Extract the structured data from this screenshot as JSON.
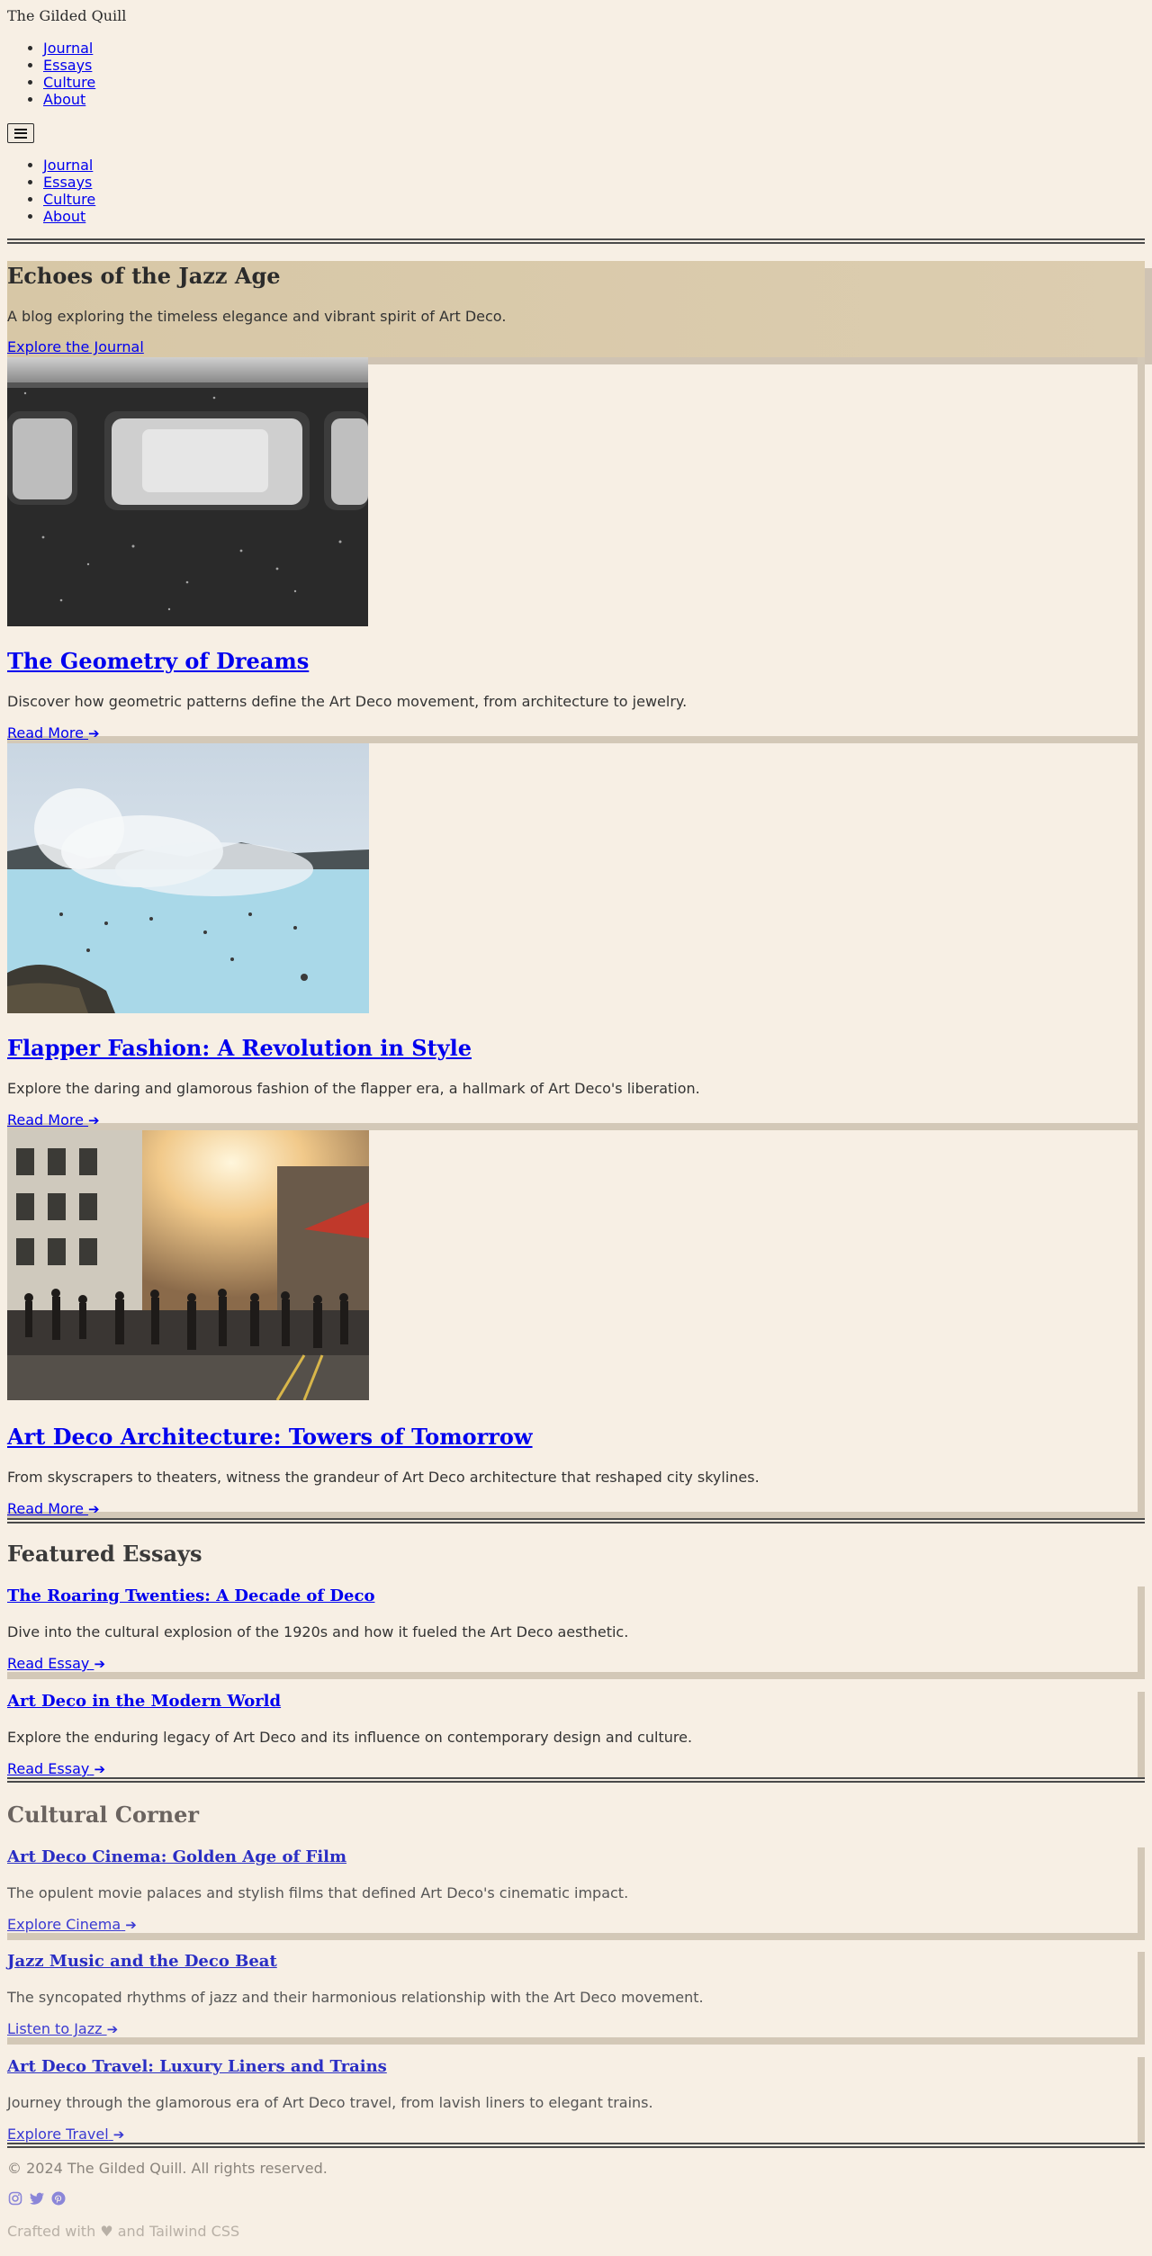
{
  "header": {
    "brand": "The Gilded Quill",
    "nav": [
      "Journal",
      "Essays",
      "Culture",
      "About"
    ],
    "mobile_nav": [
      "Journal",
      "Essays",
      "Culture",
      "About"
    ]
  },
  "hero": {
    "title": "Echoes of the Jazz Age",
    "subtitle": "A blog exploring the timeless elegance and vibrant spirit of Art Deco.",
    "cta": "Explore the Journal"
  },
  "posts": [
    {
      "title": "The Geometry of Dreams",
      "excerpt": "Discover how geometric patterns define the Art Deco movement, from architecture to jewelry.",
      "link": "Read More"
    },
    {
      "title": "Flapper Fashion: A Revolution in Style",
      "excerpt": "Explore the daring and glamorous fashion of the flapper era, a hallmark of Art Deco's liberation.",
      "link": "Read More"
    },
    {
      "title": "Art Deco Architecture: Towers of Tomorrow",
      "excerpt": "From skyscrapers to theaters, witness the grandeur of Art Deco architecture that reshaped city skylines.",
      "link": "Read More"
    }
  ],
  "featured": {
    "heading": "Featured Essays",
    "items": [
      {
        "title": "The Roaring Twenties: A Decade of Deco",
        "excerpt": "Dive into the cultural explosion of the 1920s and how it fueled the Art Deco aesthetic.",
        "link": "Read Essay"
      },
      {
        "title": "Art Deco in the Modern World",
        "excerpt": "Explore the enduring legacy of Art Deco and its influence on contemporary design and culture.",
        "link": "Read Essay"
      }
    ]
  },
  "culture": {
    "heading": "Cultural Corner",
    "items": [
      {
        "title": "Art Deco Cinema: Golden Age of Film",
        "excerpt": "The opulent movie palaces and stylish films that defined Art Deco's cinematic impact.",
        "link": "Explore Cinema"
      },
      {
        "title": "Jazz Music and the Deco Beat",
        "excerpt": "The syncopated rhythms of jazz and their harmonious relationship with the Art Deco movement.",
        "link": "Listen to Jazz"
      },
      {
        "title": "Art Deco Travel: Luxury Liners and Trains",
        "excerpt": "Journey through the glamorous era of Art Deco travel, from lavish liners to elegant trains.",
        "link": "Explore Travel"
      }
    ]
  },
  "footer": {
    "copyright": "© 2024 The Gilded Quill. All rights reserved.",
    "crafted_prefix": "Crafted with",
    "crafted_suffix": "and Tailwind CSS",
    "social_icons": [
      "instagram-icon",
      "twitter-icon",
      "pinterest-icon"
    ]
  },
  "colors": {
    "background": "#f7efe4",
    "hero": "#d7c7a6",
    "shadow": "#d3c8b7",
    "link": "#0000ee"
  }
}
